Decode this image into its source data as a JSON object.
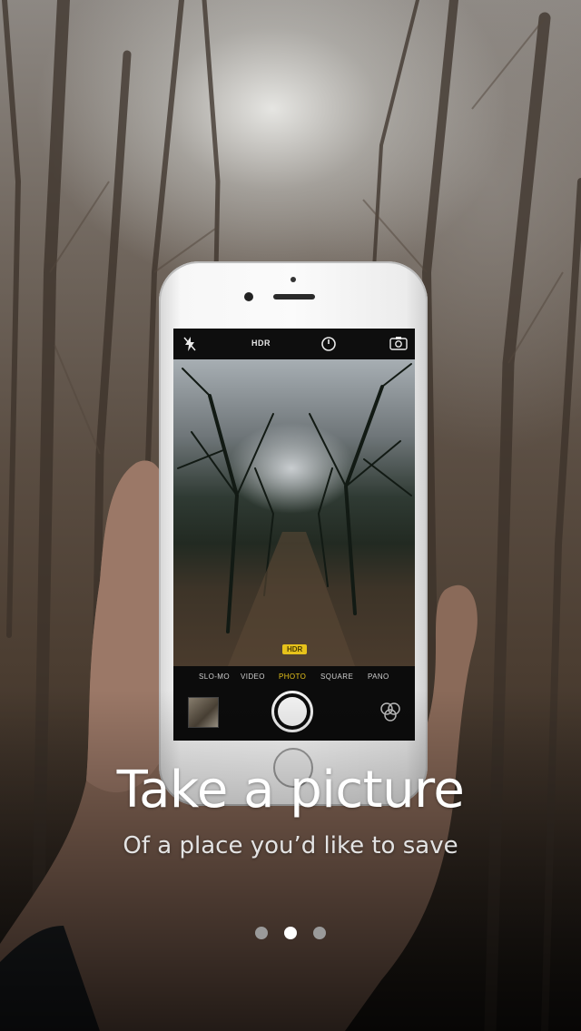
{
  "onboarding": {
    "title": "Take a picture",
    "subtitle": "Of a place you’d like to save",
    "page_count": 3,
    "current_page": 2
  },
  "camera_ui": {
    "top_bar": {
      "flash_icon": "flash-off-icon",
      "hdr_label": "HDR",
      "timer_icon": "timer-icon",
      "flip_icon": "camera-flip-icon"
    },
    "hdr_badge": "HDR",
    "modes": [
      "SLO-MO",
      "VIDEO",
      "PHOTO",
      "SQUARE",
      "PANO"
    ],
    "active_mode": "PHOTO",
    "bottom_icons": [
      "photo-thumbnail",
      "shutter-button",
      "filters-icon"
    ]
  },
  "colors": {
    "active_mode": "#e6c21b",
    "dot_active": "#ffffff",
    "dot_inactive": "#9a9a9a"
  }
}
